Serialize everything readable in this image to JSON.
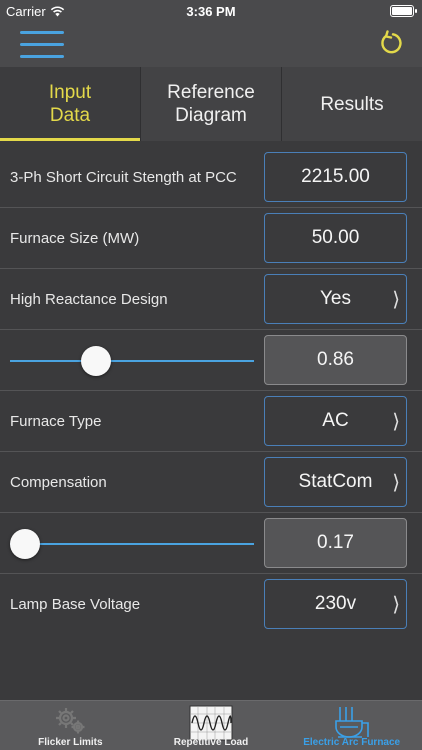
{
  "status_bar": {
    "carrier": "Carrier",
    "time": "3:36 PM"
  },
  "navbar": {
    "menu_icon": "hamburger-menu-icon",
    "refresh_icon": "refresh-icon"
  },
  "tabs": [
    {
      "label": "Input\nData",
      "active": true
    },
    {
      "label": "Reference\nDiagram",
      "active": false
    },
    {
      "label": "Results",
      "active": false
    }
  ],
  "rows": {
    "short_circuit": {
      "label": "3-Ph Short Circuit Stength at PCC",
      "value": "2215.00"
    },
    "furnace_size": {
      "label": "Furnace Size (MW)",
      "value": "50.00"
    },
    "high_reactance": {
      "label": "High Reactance Design",
      "value": "Yes",
      "chevron": "⟩"
    },
    "reactance_slider": {
      "value": "0.86",
      "level": 0.33
    },
    "furnace_type": {
      "label": "Furnace Type",
      "value": "AC",
      "chevron": "⟩"
    },
    "compensation": {
      "label": "Compensation",
      "value": "StatCom",
      "chevron": "⟩"
    },
    "compensation_slider": {
      "value": "0.17",
      "level": 0.0
    },
    "lamp_voltage": {
      "label": "Lamp Base Voltage",
      "value": "230v",
      "chevron": "⟩"
    }
  },
  "tabbar": [
    {
      "label": "Flicker Limits",
      "icon": "gears-icon",
      "active": false
    },
    {
      "label": "Repetitive Load",
      "icon": "waveform-icon",
      "active": false
    },
    {
      "label": "Electric Arc Furnace",
      "icon": "furnace-icon",
      "active": true
    }
  ],
  "colors": {
    "accent_yellow": "#e3d94a",
    "accent_blue": "#4aa3e0",
    "active_tab_blue": "#3aa0e8"
  }
}
